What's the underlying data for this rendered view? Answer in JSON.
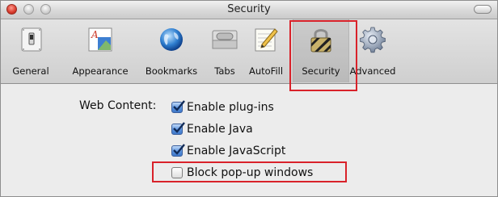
{
  "window": {
    "title": "Security"
  },
  "toolbar": {
    "items": [
      {
        "label": "General",
        "icon": "general-switch-icon"
      },
      {
        "label": "Appearance",
        "icon": "appearance-icon"
      },
      {
        "label": "Bookmarks",
        "icon": "globe-icon"
      },
      {
        "label": "Tabs",
        "icon": "tabs-icon"
      },
      {
        "label": "AutoFill",
        "icon": "autofill-pencil-icon"
      },
      {
        "label": "Security",
        "icon": "padlock-icon",
        "selected": true
      },
      {
        "label": "Advanced",
        "icon": "gear-icon"
      }
    ]
  },
  "content": {
    "web_content_label": "Web Content:",
    "options": [
      {
        "label": "Enable plug-ins",
        "checked": true
      },
      {
        "label": "Enable Java",
        "checked": true
      },
      {
        "label": "Enable JavaScript",
        "checked": true
      },
      {
        "label": "Block pop-up windows",
        "checked": false
      }
    ]
  },
  "colors": {
    "highlight": "#d9222a",
    "checkbox_accent": "#4a86d6"
  }
}
